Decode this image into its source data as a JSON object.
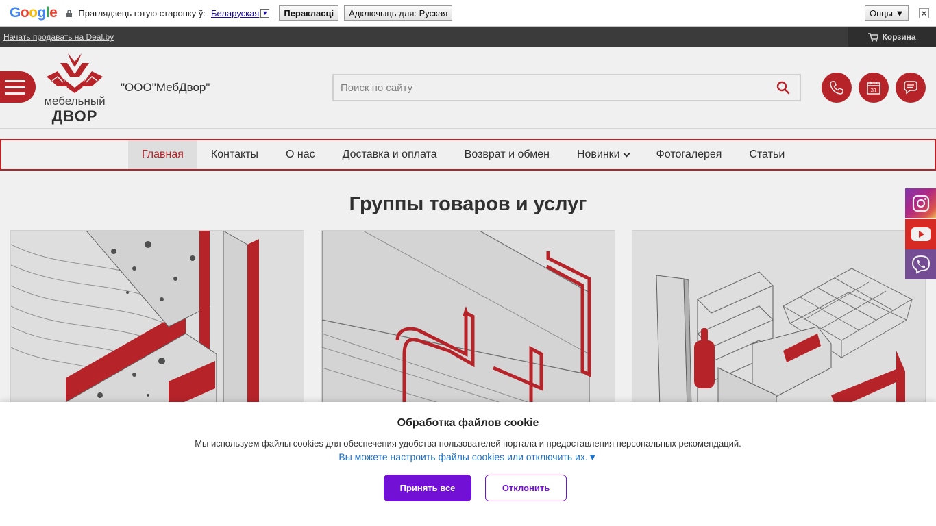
{
  "translate_bar": {
    "logo": "Google",
    "prompt": "Праглядзець гэтую старонку ў:",
    "language": "Беларуская",
    "translate_button": "Перакласці",
    "disable_button": "Адключыць для: Руская",
    "options_button": "Опцы ▼",
    "close_icon": "close-icon"
  },
  "topbar": {
    "sell_link": "Начать продавать на Deal.by",
    "cart_label": "Корзина"
  },
  "header": {
    "logo_line1": "мебельный",
    "logo_line2": "ДВОР",
    "company_name": "\"ООО\"МебДвор\"",
    "search_placeholder": "Поиск по сайту",
    "icons": [
      "menu-icon",
      "phone-icon",
      "calendar-icon",
      "chat-icon"
    ],
    "calendar_day": "31"
  },
  "nav": {
    "items": [
      {
        "label": "Главная",
        "active": true
      },
      {
        "label": "Контакты"
      },
      {
        "label": "О нас"
      },
      {
        "label": "Доставка и оплата"
      },
      {
        "label": "Возврат и обмен"
      },
      {
        "label": "Новинки",
        "has_dropdown": true
      },
      {
        "label": "Фотогалерея"
      },
      {
        "label": "Статьи"
      }
    ]
  },
  "main": {
    "title": "Группы товаров и услуг"
  },
  "social": [
    "instagram-icon",
    "youtube-icon",
    "viber-icon"
  ],
  "cookie": {
    "title": "Обработка файлов cookie",
    "text": "Мы используем файлы cookies для обеспечения удобства пользователей портала и предоставления персональных рекомендаций.",
    "link": "Вы можете настроить файлы cookies или отключить их.▼",
    "accept": "Принять все",
    "decline": "Отклонить"
  },
  "colors": {
    "brand_red": "#c2272d",
    "accent_purple": "#7210d6",
    "link_blue": "#1d72c9"
  }
}
